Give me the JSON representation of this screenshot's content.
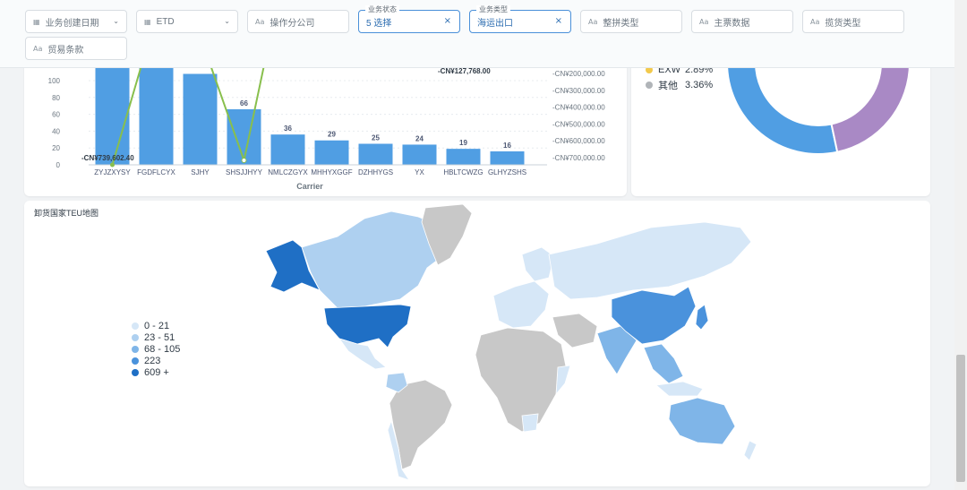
{
  "filters": [
    {
      "label": "业务创建日期",
      "icon": "calendar-icon",
      "glyph": "▦",
      "dropdown": true
    },
    {
      "label": "ETD",
      "icon": "calendar-icon",
      "glyph": "▦",
      "dropdown": true
    },
    {
      "label": "操作分公司",
      "icon": "text-icon",
      "glyph": "Aa",
      "dropdown": false
    },
    {
      "label": "业务状态",
      "value": "5 选择",
      "active": true
    },
    {
      "label": "业务类型",
      "value": "海运出口",
      "active": true
    },
    {
      "label": "整拼类型",
      "icon": "text-icon",
      "glyph": "Aa"
    },
    {
      "label": "主票数据",
      "icon": "text-icon",
      "glyph": "Aa"
    },
    {
      "label": "揽货类型",
      "icon": "text-icon",
      "glyph": "Aa"
    },
    {
      "label": "贸易条款",
      "icon": "text-icon",
      "glyph": "Aa"
    }
  ],
  "clear_glyph": "×",
  "chevron_glyph": "⌄",
  "chart_data": {
    "type": "bar",
    "xlabel": "Carrier",
    "categories": [
      "ZYJZXYSY",
      "FGDFLCYX",
      "SJHY",
      "SHSJJHYY",
      "NMLCZGYX",
      "MHHYXGGF",
      "DZHHYGS",
      "YX",
      "HBLTCWZG",
      "GLHYZSHS"
    ],
    "values": [
      140,
      140,
      108,
      66,
      36,
      29,
      25,
      24,
      19,
      16
    ],
    "bar_labels": [
      "",
      "",
      "",
      "66",
      "36",
      "29",
      "25",
      "24",
      "19",
      "16"
    ],
    "ylim": [
      0,
      100
    ],
    "y_ticks": [
      "0",
      "20",
      "40",
      "60",
      "80",
      "100"
    ],
    "y2_ticks": [
      "-CN¥200,000.00",
      "-CN¥300,000.00",
      "-CN¥400,000.00",
      "-CN¥500,000.00",
      "-CN¥600,000.00",
      "-CN¥700,000.00"
    ],
    "annotations": [
      "-CN¥739,602.40",
      "-CN¥127,768.00"
    ],
    "bar_color": "#509ee3",
    "line_color": "#88bf4d"
  },
  "pie": {
    "legend": [
      {
        "label": "EXW",
        "value": "2.89%",
        "color": "#f2c94c"
      },
      {
        "label": "其他",
        "value": "3.36%",
        "color": "#b0b4b8"
      }
    ],
    "colors": {
      "blue": "#509ee3",
      "purple": "#a989c5"
    }
  },
  "map": {
    "title": "卸货国家TEU地图",
    "legend": [
      {
        "label": "0 - 21",
        "color": "#d6e7f7"
      },
      {
        "label": "23 - 51",
        "color": "#aed0f0"
      },
      {
        "label": "68 - 105",
        "color": "#7fb5e8"
      },
      {
        "label": "223",
        "color": "#4a92dc"
      },
      {
        "label": "609 +",
        "color": "#1f6fc5"
      }
    ],
    "no_data_color": "#c8c8c8"
  }
}
